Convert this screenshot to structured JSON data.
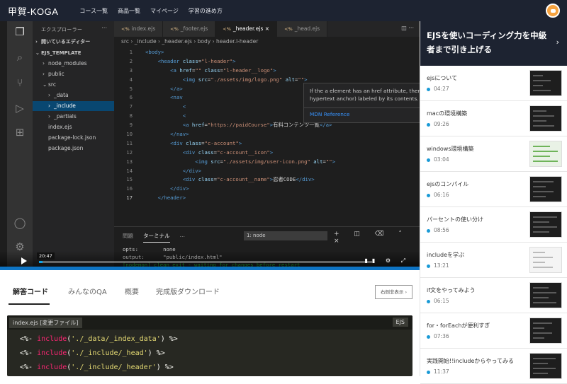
{
  "nav": {
    "logo": "甲賀-KOGA",
    "links": [
      "コース一覧",
      "商品一覧",
      "マイページ",
      "学習の進め方"
    ]
  },
  "vscode": {
    "explorer_title": "エクスプローラー",
    "sidebar_rows": [
      {
        "label": "開いているエディター",
        "arrow": "›"
      },
      {
        "label": "EJS_TEMPLATE",
        "arrow": "⌄"
      },
      {
        "label": "node_modules",
        "arrow": "›"
      },
      {
        "label": "public",
        "arrow": "›"
      },
      {
        "label": "src",
        "arrow": "⌄"
      },
      {
        "label": "_data",
        "arrow": "›"
      },
      {
        "label": "_include",
        "arrow": "›"
      },
      {
        "label": "_partials",
        "arrow": "›"
      },
      {
        "label": "index.ejs",
        "arrow": ""
      },
      {
        "label": "package-lock.json",
        "arrow": ""
      },
      {
        "label": "package.json",
        "arrow": ""
      }
    ],
    "tabs": [
      "index.ejs",
      "_footer.ejs",
      "_header.ejs",
      "_head.ejs"
    ],
    "tab_close": "×",
    "breadcrumb": "src  ›  _include  ›  _header.ejs  ›  body  ›  header.l-header",
    "code_lines": [
      {
        "n": "1",
        "html": "<span class='tag'>&lt;body&gt;</span>"
      },
      {
        "n": "2",
        "html": "    <span class='tag'>&lt;header</span> <span class='attr'>class</span>=<span class='str'>\"l-header\"</span><span class='tag'>&gt;</span>"
      },
      {
        "n": "3",
        "html": "        <span class='tag'>&lt;a</span> <span class='attr'>href</span>=<span class='str'>\"\"</span> <span class='attr'>class</span>=<span class='str'>\"l-header__logo\"</span><span class='tag'>&gt;</span>"
      },
      {
        "n": "4",
        "html": "            <span class='tag'>&lt;img</span> <span class='attr'>src</span>=<span class='str'>\"./assets/img/logo.png\"</span> <span class='attr'>alt</span>=<span class='str'>\"\"</span><span class='tag'>&gt;</span>"
      },
      {
        "n": "5",
        "html": "        <span class='tag'>&lt;/a&gt;</span>"
      },
      {
        "n": "6",
        "html": "        <span class='tag'>&lt;nav</span>"
      },
      {
        "n": "7",
        "html": "            <span class='tag'>&lt;</span>"
      },
      {
        "n": "8",
        "html": "            <span class='tag'>&lt;</span>"
      },
      {
        "n": "9",
        "html": "            <span class='tag'>&lt;a</span> <span class='attr'>href</span>=<span class='str'>\"https://paidCourse\"</span><span class='tag'>&gt;</span><span class='txt'>有料コンテンツ一覧</span><span class='tag'>&lt;/a&gt;</span>"
      },
      {
        "n": "10",
        "html": "        <span class='tag'>&lt;/nav&gt;</span>"
      },
      {
        "n": "11",
        "html": "        <span class='tag'>&lt;div</span> <span class='attr'>class</span>=<span class='str'>\"c-account\"</span><span class='tag'>&gt;</span>"
      },
      {
        "n": "12",
        "html": "            <span class='tag'>&lt;div</span> <span class='attr'>class</span>=<span class='str'>\"c-account__icon\"</span><span class='tag'>&gt;</span>"
      },
      {
        "n": "13",
        "html": "                <span class='tag'>&lt;img</span> <span class='attr'>src</span>=<span class='str'>\"./assets/img/user-icon.png\"</span> <span class='attr'>alt</span>=<span class='str'>\"\"</span><span class='tag'>&gt;</span>"
      },
      {
        "n": "14",
        "html": "            <span class='tag'>&lt;/div&gt;</span>"
      },
      {
        "n": "15",
        "html": "            <span class='tag'>&lt;div</span> <span class='attr'>class</span>=<span class='str'>\"c-account__name\"</span><span class='tag'>&gt;</span><span class='txt'>忍者CODE</span><span class='tag'>&lt;/div&gt;</span>"
      },
      {
        "n": "16",
        "html": "        <span class='tag'>&lt;/div&gt;</span>"
      },
      {
        "n": "17",
        "html": "    <span class='tag'>&lt;/header&gt;</span>"
      }
    ],
    "hover_text": "If the a element has an href attribute, then it represents a hyperlink (a hypertext anchor) labeled by its contents.",
    "hover_link": "MDN Reference",
    "terminal_tabs": [
      "問題",
      "ターミナル",
      "…"
    ],
    "terminal_select": "1: node",
    "terminal_lines": [
      {
        "text": "opts:        none",
        "green": false
      },
      {
        "text": "output:      \"public/index.html\"",
        "green": false
      },
      {
        "text": "[nodemon] clean exit - waiting for changes before restart",
        "green": true
      },
      {
        "text": "▯",
        "green": false
      }
    ],
    "video_time": "20:47",
    "progress": 0.01
  },
  "lesson_panel": {
    "title": "EJSを使いコーディング力を中級者まで引き上げる",
    "arrow": "›",
    "lessons": [
      {
        "title": "ejsについて",
        "duration": "04:27",
        "thumb": "dark"
      },
      {
        "title": "macの環境構築",
        "duration": "09:26",
        "thumb": "dark"
      },
      {
        "title": "windows環境構築",
        "duration": "03:04",
        "thumb": "green"
      },
      {
        "title": "ejsのコンパイル",
        "duration": "06:16",
        "thumb": "dark"
      },
      {
        "title": "パーセントの使い分け",
        "duration": "08:56",
        "thumb": "dark"
      },
      {
        "title": "includeを学ぶ",
        "duration": "13:21",
        "thumb": "light"
      },
      {
        "title": "if文をやってみよう",
        "duration": "06:15",
        "thumb": "dark"
      },
      {
        "title": "for・forEachが便利すぎ",
        "duration": "07:36",
        "thumb": "dark"
      },
      {
        "title": "実践開始!!includeからやってみる",
        "duration": "11:37",
        "thumb": "dark"
      }
    ]
  },
  "bottom": {
    "tabs": [
      "解答コード",
      "みんなのQA",
      "概要",
      "完成版ダウンロード"
    ],
    "toggle_label": "右側非表示",
    "toggle_arrow": "›",
    "file_label": "index.ejs [変更ファイル]",
    "lang_label": "EJS",
    "code_lines": [
      "<%- <span class='kw'>include</span>(<span class='st'>'./_data/_index_data'</span>) %>",
      "<%- <span class='kw'>include</span>(<span class='st'>'./_include/_head'</span>) %>",
      "<%- <span class='kw'>include</span>(<span class='st'>'./_include/_header'</span>) %>"
    ]
  },
  "colors": {
    "nav_bg": "#1d2331",
    "accent": "#0e74c4",
    "vscode_bg": "#1e1e1e",
    "code_panel_bg": "#272822"
  }
}
